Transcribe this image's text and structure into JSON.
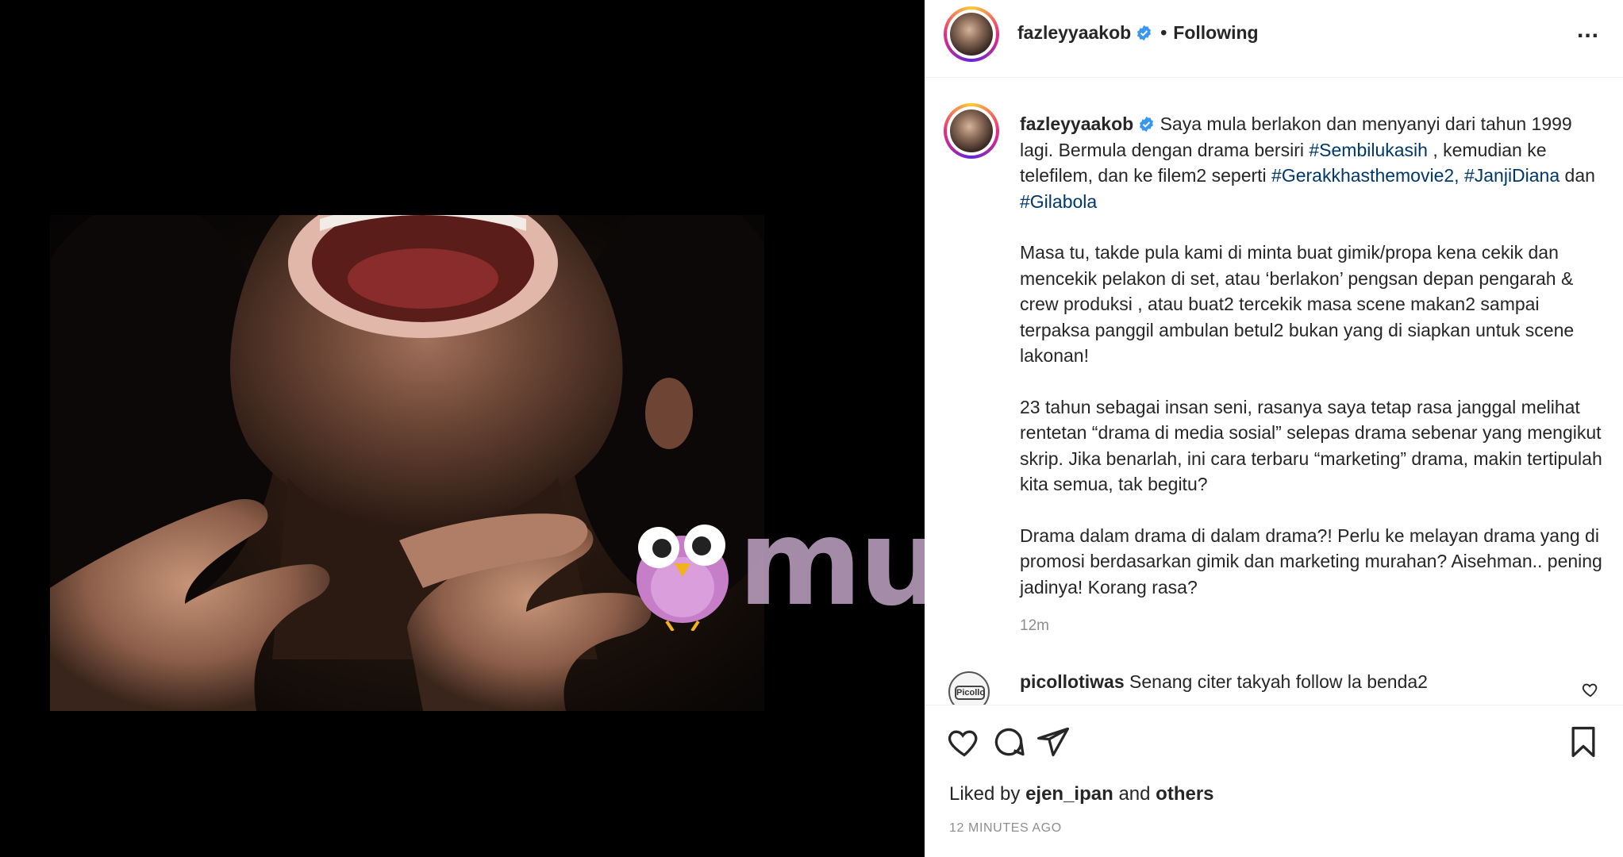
{
  "post": {
    "username": "fazleyyaakob",
    "verified": true,
    "follow_status": "Following",
    "separator": "•",
    "more_label": "..."
  },
  "caption": {
    "username": "fazleyyaakob",
    "p1_a": "Saya mula berlakon dan menyanyi dari tahun 1999 lagi. Bermula dengan drama bersiri ",
    "tag1": "#Sembilukasih",
    "p1_b": " , kemudian ke telefilem, dan ke filem2 seperti ",
    "tag2": "#Gerakkhasthemovie2,",
    "p1_c": " ",
    "tag3": "#JanjiDiana",
    "p1_d": " dan ",
    "tag4": "#Gilabola",
    "p2": "Masa tu, takde pula kami di minta buat gimik/propa kena cekik dan mencekik pelakon di set, atau ‘berlakon’ pengsan depan pengarah & crew produksi , atau buat2 tercekik masa scene makan2 sampai terpaksa panggil ambulan betul2 bukan yang di siapkan untuk scene lakonan!",
    "p3": "23 tahun sebagai insan seni, rasanya saya tetap rasa janggal melihat rentetan “drama di media sosial” selepas drama sebenar yang mengikut skrip. Jika benarlah, ini cara terbaru “marketing” drama, makin tertipulah kita semua, tak begitu?",
    "p4": "Drama dalam drama di dalam drama?! Perlu ke melayan drama yang di promosi berdasarkan gimik dan marketing murahan? Aisehman.. pening jadinya! Korang rasa?",
    "time": "12m"
  },
  "comment": {
    "username": "picollotiwas",
    "text": "Senang citer takyah follow la benda2",
    "avatar_badge": "Picollo"
  },
  "likes": {
    "prefix": "Liked by",
    "user": "ejen_ipan",
    "and": "and",
    "others": "others"
  },
  "posted_ago": "12 MINUTES AGO",
  "watermark": {
    "text": "murai"
  },
  "colors": {
    "verified": "#3897f0",
    "hashtag": "#00376b",
    "watermark": "#c8aacd"
  }
}
